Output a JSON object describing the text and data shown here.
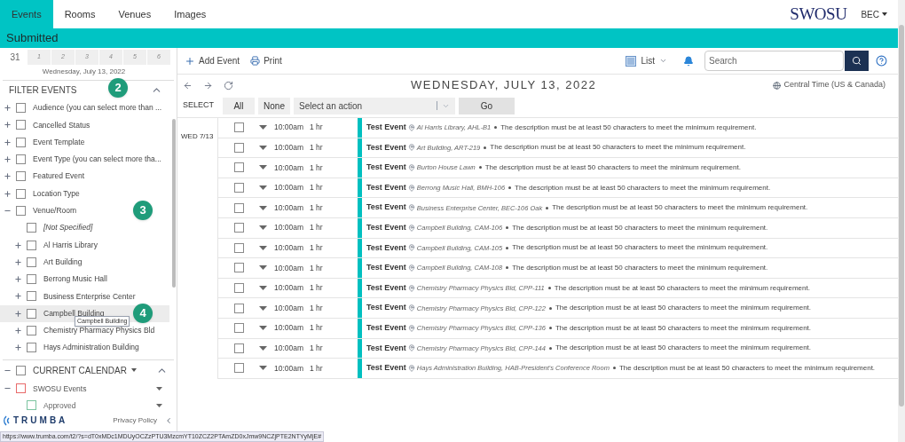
{
  "nav": {
    "tabs": [
      {
        "label": "Events",
        "selected": true
      },
      {
        "label": "Rooms",
        "selected": false
      },
      {
        "label": "Venues",
        "selected": false
      },
      {
        "label": "Images",
        "selected": false
      }
    ],
    "logo": "SWOSU",
    "user": "BEC"
  },
  "title_bar": "Submitted",
  "mini_calendar": {
    "days": [
      {
        "label": "31",
        "shaded": false
      },
      {
        "label": "1",
        "shaded": true
      },
      {
        "label": "2",
        "shaded": true
      },
      {
        "label": "3",
        "shaded": true
      },
      {
        "label": "4",
        "shaded": true
      },
      {
        "label": "5",
        "shaded": true
      },
      {
        "label": "6",
        "shaded": true
      }
    ],
    "caption": "Wednesday, July 13, 2022"
  },
  "filter": {
    "title": "FILTER EVENTS",
    "badge": "2",
    "expanded": true,
    "items": [
      {
        "label": "Audience (you can select more than ...",
        "checked": false,
        "expandable": true,
        "expanded": false
      },
      {
        "label": "Cancelled Status",
        "checked": false,
        "expandable": true,
        "expanded": false
      },
      {
        "label": "Event Template",
        "checked": false,
        "expandable": true,
        "expanded": false
      },
      {
        "label": "Event Type (you can select more tha...",
        "checked": false,
        "expandable": true,
        "expanded": false
      },
      {
        "label": "Featured Event",
        "checked": false,
        "expandable": true,
        "expanded": false
      },
      {
        "label": "Location Type",
        "checked": false,
        "expandable": true,
        "expanded": false
      },
      {
        "label": "Venue/Room",
        "checked": false,
        "expandable": true,
        "expanded": true,
        "badge": "3",
        "children": [
          {
            "label": "[Not Specified]",
            "checked": false,
            "italic": true
          },
          {
            "label": "Al Harris Library",
            "checked": false,
            "expandable": true,
            "expanded": false
          },
          {
            "label": "Art Building",
            "checked": false,
            "expandable": true,
            "expanded": false
          },
          {
            "label": "Berrong Music Hall",
            "checked": false,
            "expandable": true,
            "expanded": false
          },
          {
            "label": "Business Enterprise Center",
            "checked": false,
            "expandable": true,
            "expanded": false
          },
          {
            "label": "Campbell Building",
            "checked": false,
            "expandable": true,
            "expanded": false,
            "hovered": true,
            "badge": "4",
            "tooltip": "Campbell Building"
          },
          {
            "label": "Chemistry Pharmacy Physics Bld",
            "checked": false,
            "expandable": true,
            "expanded": false
          },
          {
            "label": "Hays Administration Building",
            "checked": false,
            "expandable": true,
            "expanded": false
          }
        ]
      }
    ]
  },
  "current_calendar": {
    "title": "CURRENT CALENDAR",
    "checked": false,
    "expanded": true,
    "calendars": [
      {
        "label": "SWOSU Events",
        "color": "#e86a6a",
        "checked": false,
        "expanded": true,
        "children": [
          {
            "label": "Approved",
            "color": "#7cc4a0",
            "checked": false
          }
        ]
      }
    ]
  },
  "footer": {
    "privacy": "Privacy Policy",
    "brand": "TRUMBA"
  },
  "status_url": "https://www.trumba.com/t2/?s=dT0xMDc1MDUyOCZzPTU3MzcmYT10ZCZ2PTAmZD0xJmw9NCZjPTE2NTYyMjE#",
  "toolbar": {
    "add": "Add Event",
    "print": "Print",
    "view": "List",
    "search_placeholder": "Search"
  },
  "date_heading": "WEDNESDAY, JULY 13, 2022",
  "timezone": "Central Time (US & Canada)",
  "select": {
    "label": "SELECT",
    "all": "All",
    "none": "None",
    "action_placeholder": "Select an action",
    "go": "Go"
  },
  "day_label": "WED 7/13",
  "events": [
    {
      "time": "10:00am",
      "duration": "1 hr",
      "title": "Test Event",
      "location": "Al Harris Library, AHL-B1",
      "description": "The description must be at least 50 characters to meet the minimum requirement.",
      "checked": false
    },
    {
      "time": "10:00am",
      "duration": "1 hr",
      "title": "Test Event",
      "location": "Art Building, ART-219",
      "description": "The description must be at least 50 characters to meet the minimum requirement.",
      "checked": false
    },
    {
      "time": "10:00am",
      "duration": "1 hr",
      "title": "Test Event",
      "location": "Burton House Lawn",
      "description": "The description must be at least 50 characters to meet the minimum requirement.",
      "checked": false
    },
    {
      "time": "10:00am",
      "duration": "1 hr",
      "title": "Test Event",
      "location": "Berrong Music Hall, BMH-106",
      "description": "The description must be at least 50 characters to meet the minimum requirement.",
      "checked": false
    },
    {
      "time": "10:00am",
      "duration": "1 hr",
      "title": "Test Event",
      "location": "Business Enterprise Center, BEC-106 Oak",
      "description": "The description must be at least 50 characters to meet the minimum requirement.",
      "checked": false
    },
    {
      "time": "10:00am",
      "duration": "1 hr",
      "title": "Test Event",
      "location": "Campbell Building, CAM-106",
      "description": "The description must be at least 50 characters to meet the minimum requirement.",
      "checked": false
    },
    {
      "time": "10:00am",
      "duration": "1 hr",
      "title": "Test Event",
      "location": "Campbell Building, CAM-105",
      "description": "The description must be at least 50 characters to meet the minimum requirement.",
      "checked": false
    },
    {
      "time": "10:00am",
      "duration": "1 hr",
      "title": "Test Event",
      "location": "Campbell Building, CAM-108",
      "description": "The description must be at least 50 characters to meet the minimum requirement.",
      "checked": false
    },
    {
      "time": "10:00am",
      "duration": "1 hr",
      "title": "Test Event",
      "location": "Chemistry Pharmacy Physics Bld, CPP-111",
      "description": "The description must be at least 50 characters to meet the minimum requirement.",
      "checked": false
    },
    {
      "time": "10:00am",
      "duration": "1 hr",
      "title": "Test Event",
      "location": "Chemistry Pharmacy Physics Bld, CPP-122",
      "description": "The description must be at least 50 characters to meet the minimum requirement.",
      "checked": false
    },
    {
      "time": "10:00am",
      "duration": "1 hr",
      "title": "Test Event",
      "location": "Chemistry Pharmacy Physics Bld, CPP-136",
      "description": "The description must be at least 50 characters to meet the minimum requirement.",
      "checked": false
    },
    {
      "time": "10:00am",
      "duration": "1 hr",
      "title": "Test Event",
      "location": "Chemistry Pharmacy Physics Bld, CPP-144",
      "description": "The description must be at least 50 characters to meet the minimum requirement.",
      "checked": false
    },
    {
      "time": "10:00am",
      "duration": "1 hr",
      "title": "Test Event",
      "location": "Hays Administration Building, HAB-President's Conference Room",
      "description": "The description must be at least 50 characters to meet the minimum requirement.",
      "checked": false
    }
  ]
}
